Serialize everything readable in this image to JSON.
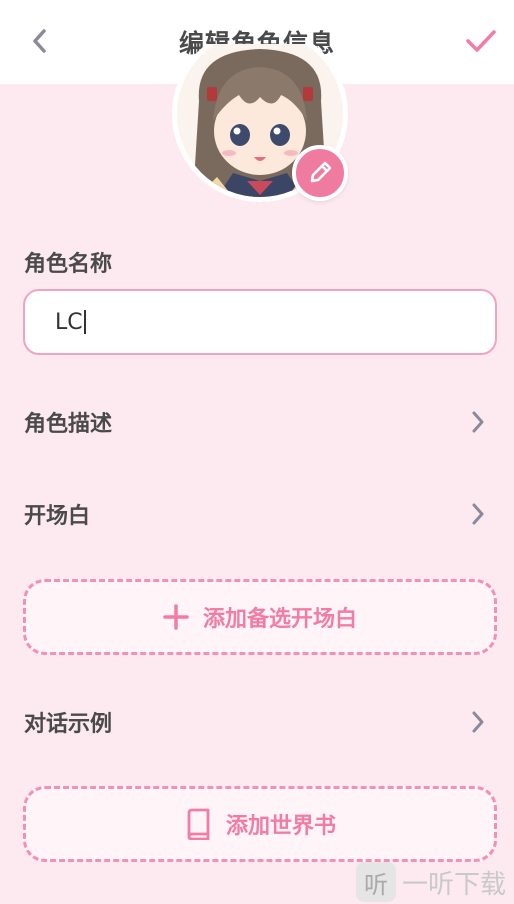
{
  "header": {
    "title": "编辑角色信息",
    "back_icon": "chevron-left-icon",
    "confirm_icon": "check-icon"
  },
  "avatar": {
    "edit_icon": "pencil-icon"
  },
  "name_section": {
    "label": "角色名称",
    "value": "LC"
  },
  "rows": [
    {
      "label": "角色描述",
      "icon": "chevron-right-icon"
    },
    {
      "label": "开场白",
      "icon": "chevron-right-icon"
    },
    {
      "label": "对话示例",
      "icon": "chevron-right-icon"
    }
  ],
  "buttons": {
    "add_greeting": {
      "label": "添加备选开场白",
      "icon": "plus-icon"
    },
    "add_world_book": {
      "label": "添加世界书",
      "icon": "book-icon"
    }
  },
  "watermark": {
    "logo_text": "听",
    "text": "一听下载"
  },
  "colors": {
    "accent": "#f27ca3",
    "background": "#fdeaf1",
    "text": "#4a4a4a"
  }
}
